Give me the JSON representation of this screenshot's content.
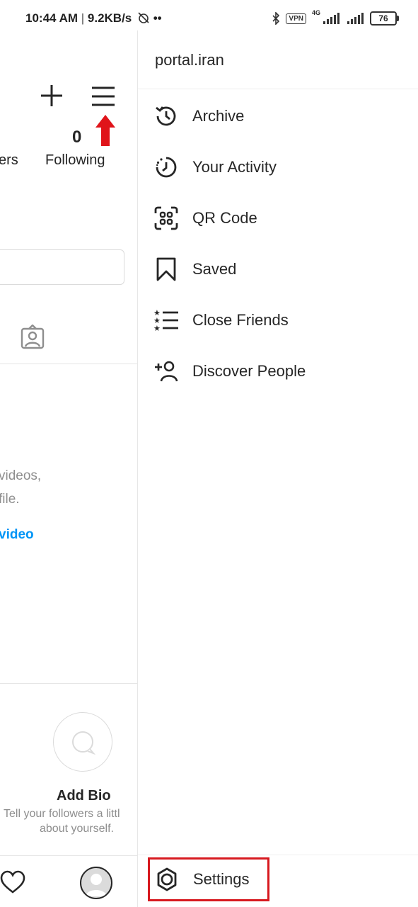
{
  "status_bar": {
    "time": "10:44 AM",
    "net_speed": "9.2KB/s",
    "vpn": "VPN",
    "network": "4G",
    "battery": "76"
  },
  "profile": {
    "following_count": "0",
    "following_label": "Following",
    "followers_fragment": "ers",
    "empty_line_1": "videos,",
    "empty_line_2": "file.",
    "share_link": "video",
    "add_bio_title": "Add Bio",
    "add_bio_desc_1": "Tell your followers a littl",
    "add_bio_desc_2": "about yourself."
  },
  "drawer": {
    "username": "portal.iran",
    "items": [
      {
        "label": "Archive",
        "icon": "archive-icon"
      },
      {
        "label": "Your Activity",
        "icon": "activity-icon"
      },
      {
        "label": "QR Code",
        "icon": "qr-code-icon"
      },
      {
        "label": "Saved",
        "icon": "bookmark-icon"
      },
      {
        "label": "Close Friends",
        "icon": "close-friends-icon"
      },
      {
        "label": "Discover People",
        "icon": "add-person-icon"
      }
    ],
    "settings_label": "Settings"
  },
  "colors": {
    "highlight": "#d7191f",
    "link": "#0095f6",
    "text": "#262626",
    "muted": "#8e8e8e"
  }
}
